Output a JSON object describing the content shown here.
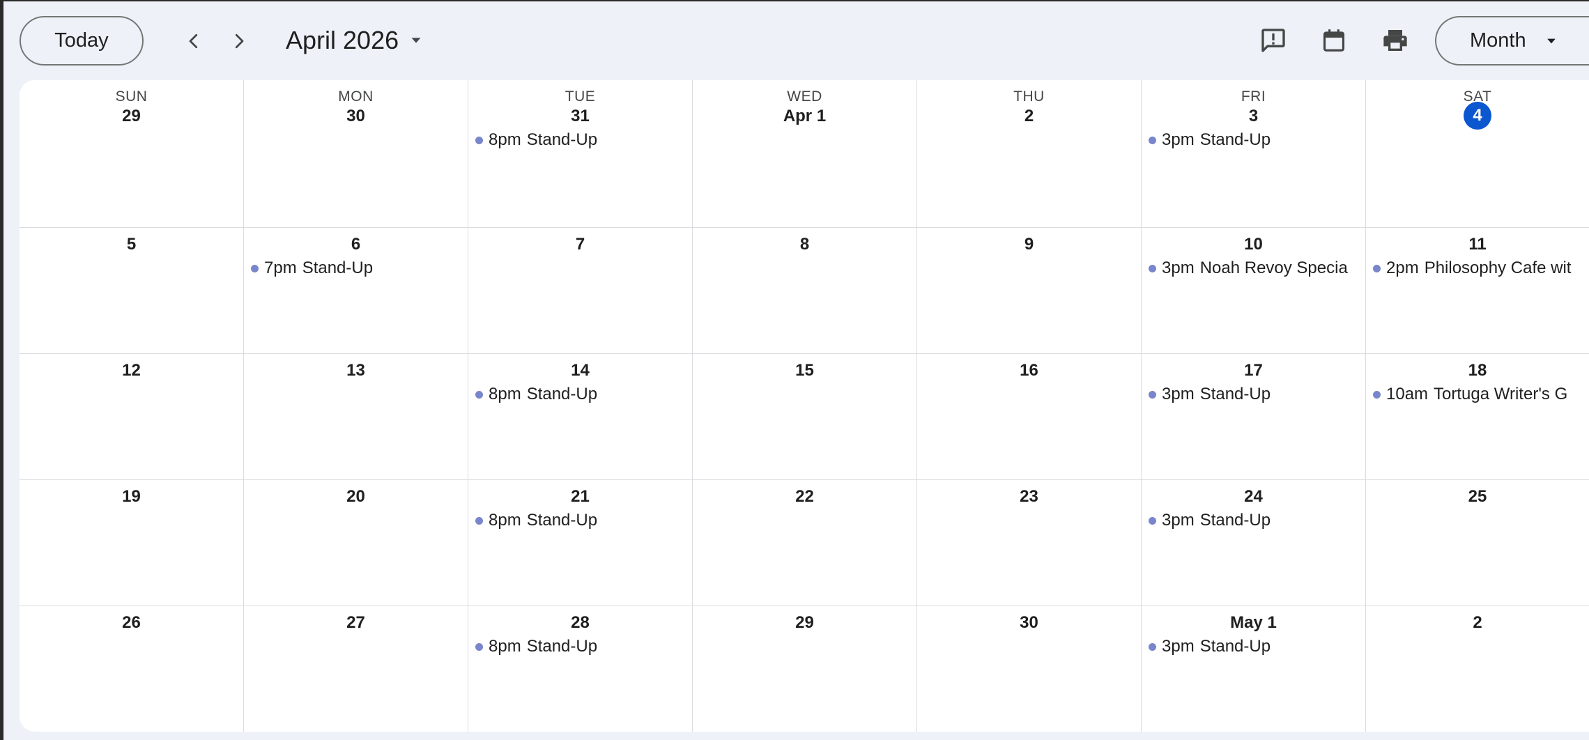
{
  "toolbar": {
    "today_label": "Today",
    "prev_icon": "chevron-left-icon",
    "next_icon": "chevron-right-icon",
    "month_title": "April 2026",
    "view_label": "Month"
  },
  "colors": {
    "background": "#eef2f8",
    "today_highlight": "#0b57d0",
    "event_dot": "#7986cb"
  },
  "weekdays": [
    "SUN",
    "MON",
    "TUE",
    "WED",
    "THU",
    "FRI",
    "SAT"
  ],
  "weeks": [
    [
      {
        "date": "29",
        "events": []
      },
      {
        "date": "30",
        "events": []
      },
      {
        "date": "31",
        "events": [
          {
            "time": "8pm",
            "title": "Stand-Up"
          }
        ]
      },
      {
        "date": "Apr 1",
        "events": []
      },
      {
        "date": "2",
        "events": []
      },
      {
        "date": "3",
        "events": [
          {
            "time": "3pm",
            "title": "Stand-Up"
          }
        ]
      },
      {
        "date": "4",
        "today": true,
        "events": []
      }
    ],
    [
      {
        "date": "5",
        "events": []
      },
      {
        "date": "6",
        "events": [
          {
            "time": "7pm",
            "title": "Stand-Up"
          }
        ]
      },
      {
        "date": "7",
        "events": []
      },
      {
        "date": "8",
        "events": []
      },
      {
        "date": "9",
        "events": []
      },
      {
        "date": "10",
        "events": [
          {
            "time": "3pm",
            "title": "Noah Revoy Specia"
          }
        ]
      },
      {
        "date": "11",
        "events": [
          {
            "time": "2pm",
            "title": "Philosophy Cafe wit"
          }
        ]
      }
    ],
    [
      {
        "date": "12",
        "events": []
      },
      {
        "date": "13",
        "events": []
      },
      {
        "date": "14",
        "events": [
          {
            "time": "8pm",
            "title": "Stand-Up"
          }
        ]
      },
      {
        "date": "15",
        "events": []
      },
      {
        "date": "16",
        "events": []
      },
      {
        "date": "17",
        "events": [
          {
            "time": "3pm",
            "title": "Stand-Up"
          }
        ]
      },
      {
        "date": "18",
        "events": [
          {
            "time": "10am",
            "title": "Tortuga Writer's G"
          }
        ]
      }
    ],
    [
      {
        "date": "19",
        "events": []
      },
      {
        "date": "20",
        "events": []
      },
      {
        "date": "21",
        "events": [
          {
            "time": "8pm",
            "title": "Stand-Up"
          }
        ]
      },
      {
        "date": "22",
        "events": []
      },
      {
        "date": "23",
        "events": []
      },
      {
        "date": "24",
        "events": [
          {
            "time": "3pm",
            "title": "Stand-Up"
          }
        ]
      },
      {
        "date": "25",
        "events": []
      }
    ],
    [
      {
        "date": "26",
        "events": []
      },
      {
        "date": "27",
        "events": []
      },
      {
        "date": "28",
        "events": [
          {
            "time": "8pm",
            "title": "Stand-Up"
          }
        ]
      },
      {
        "date": "29",
        "events": []
      },
      {
        "date": "30",
        "events": []
      },
      {
        "date": "May 1",
        "events": [
          {
            "time": "3pm",
            "title": "Stand-Up"
          }
        ]
      },
      {
        "date": "2",
        "events": []
      }
    ]
  ]
}
